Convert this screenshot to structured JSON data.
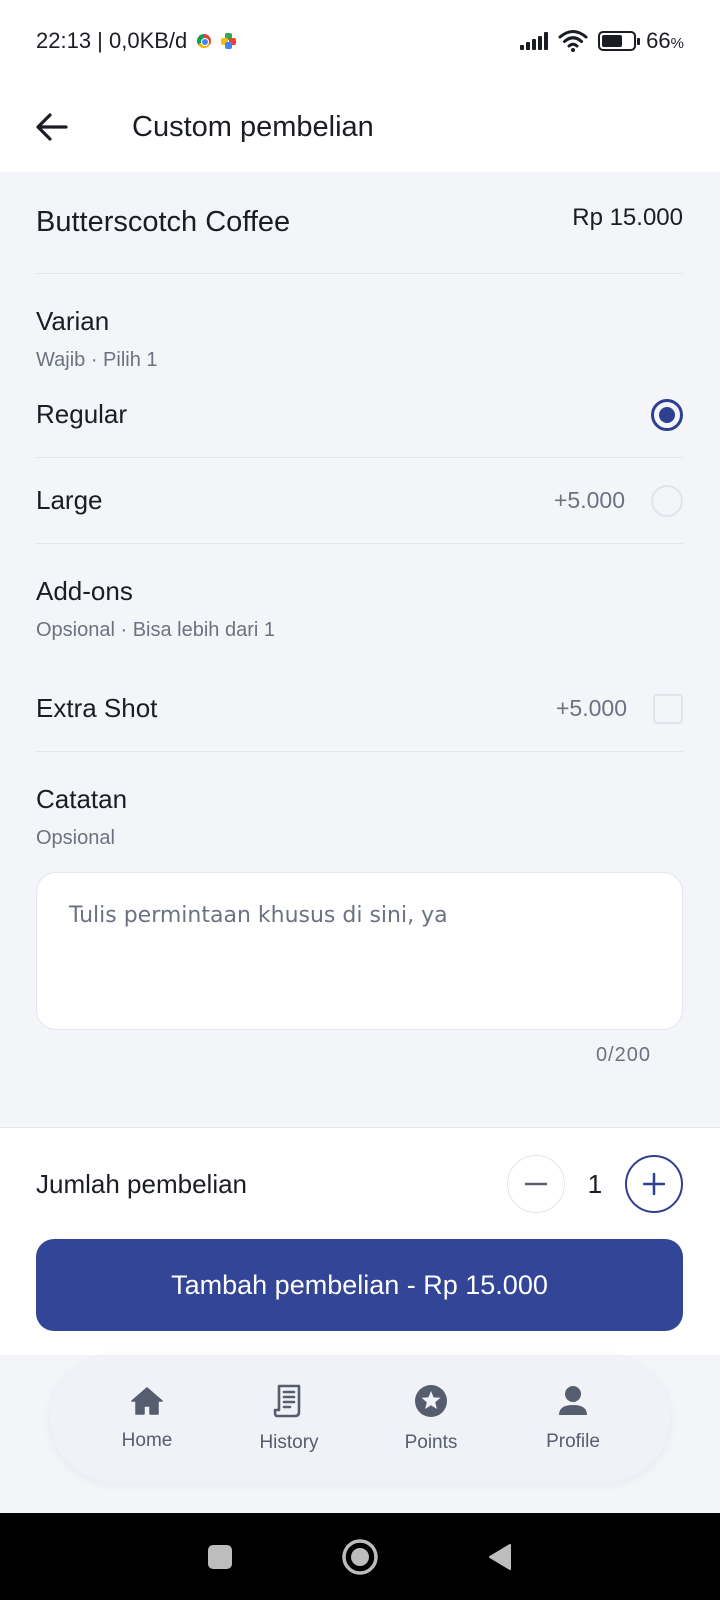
{
  "status_bar": {
    "time_speed": "22:13 | 0,0KB/d",
    "battery": "66",
    "battery_unit": "%"
  },
  "header": {
    "title": "Custom pembelian"
  },
  "product": {
    "name": "Butterscotch Coffee",
    "price": "Rp 15.000"
  },
  "variant": {
    "title": "Varian",
    "subtitle": "Wajib · Pilih 1",
    "options": [
      {
        "label": "Regular",
        "price": "",
        "selected": true
      },
      {
        "label": "Large",
        "price": "+5.000",
        "selected": false
      }
    ]
  },
  "addons": {
    "title": "Add-ons",
    "subtitle": "Opsional · Bisa lebih dari 1",
    "options": [
      {
        "label": "Extra Shot",
        "price": "+5.000",
        "checked": false
      }
    ]
  },
  "notes": {
    "title": "Catatan",
    "subtitle": "Opsional",
    "placeholder": "Tulis permintaan khusus di sini, ya",
    "value": "",
    "counter": "0/200"
  },
  "quantity": {
    "label": "Jumlah pembelian",
    "value": "1"
  },
  "add_button": {
    "label": "Tambah pembelian - Rp 15.000"
  },
  "nav": {
    "items": [
      {
        "label": "Home",
        "icon": "home-icon"
      },
      {
        "label": "History",
        "icon": "receipt-icon"
      },
      {
        "label": "Points",
        "icon": "star-icon"
      },
      {
        "label": "Profile",
        "icon": "person-icon"
      }
    ]
  },
  "colors": {
    "primary": "#334596",
    "background": "#f4f5f9",
    "muted_text": "#6b7280"
  }
}
